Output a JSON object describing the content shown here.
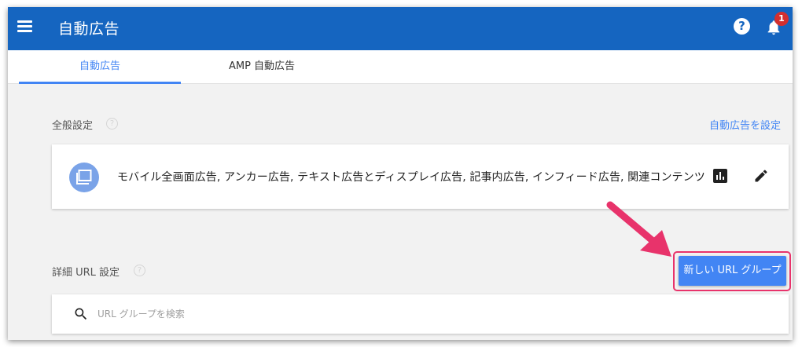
{
  "header": {
    "title": "自動広告",
    "help_label": "?",
    "notification_count": "1",
    "color": "#1565c0"
  },
  "tabs": [
    {
      "label": "自動広告",
      "active": true
    },
    {
      "label": "AMP 自動広告",
      "active": false
    }
  ],
  "general": {
    "title": "全般設定",
    "help_label": "?",
    "action_link": "自動広告を設定",
    "summary": "モバイル全画面広告, アンカー広告, テキスト広告とディスプレイ広告, 記事内広告, インフィード広告, 関連コンテンツ"
  },
  "advanced": {
    "title": "詳細 URL 設定",
    "help_label": "?",
    "new_group_button": "新しい URL グループ"
  },
  "search": {
    "placeholder": "URL グループを検索",
    "value": ""
  },
  "accent_color": "#4285f4",
  "highlight_color": "#e8336b"
}
